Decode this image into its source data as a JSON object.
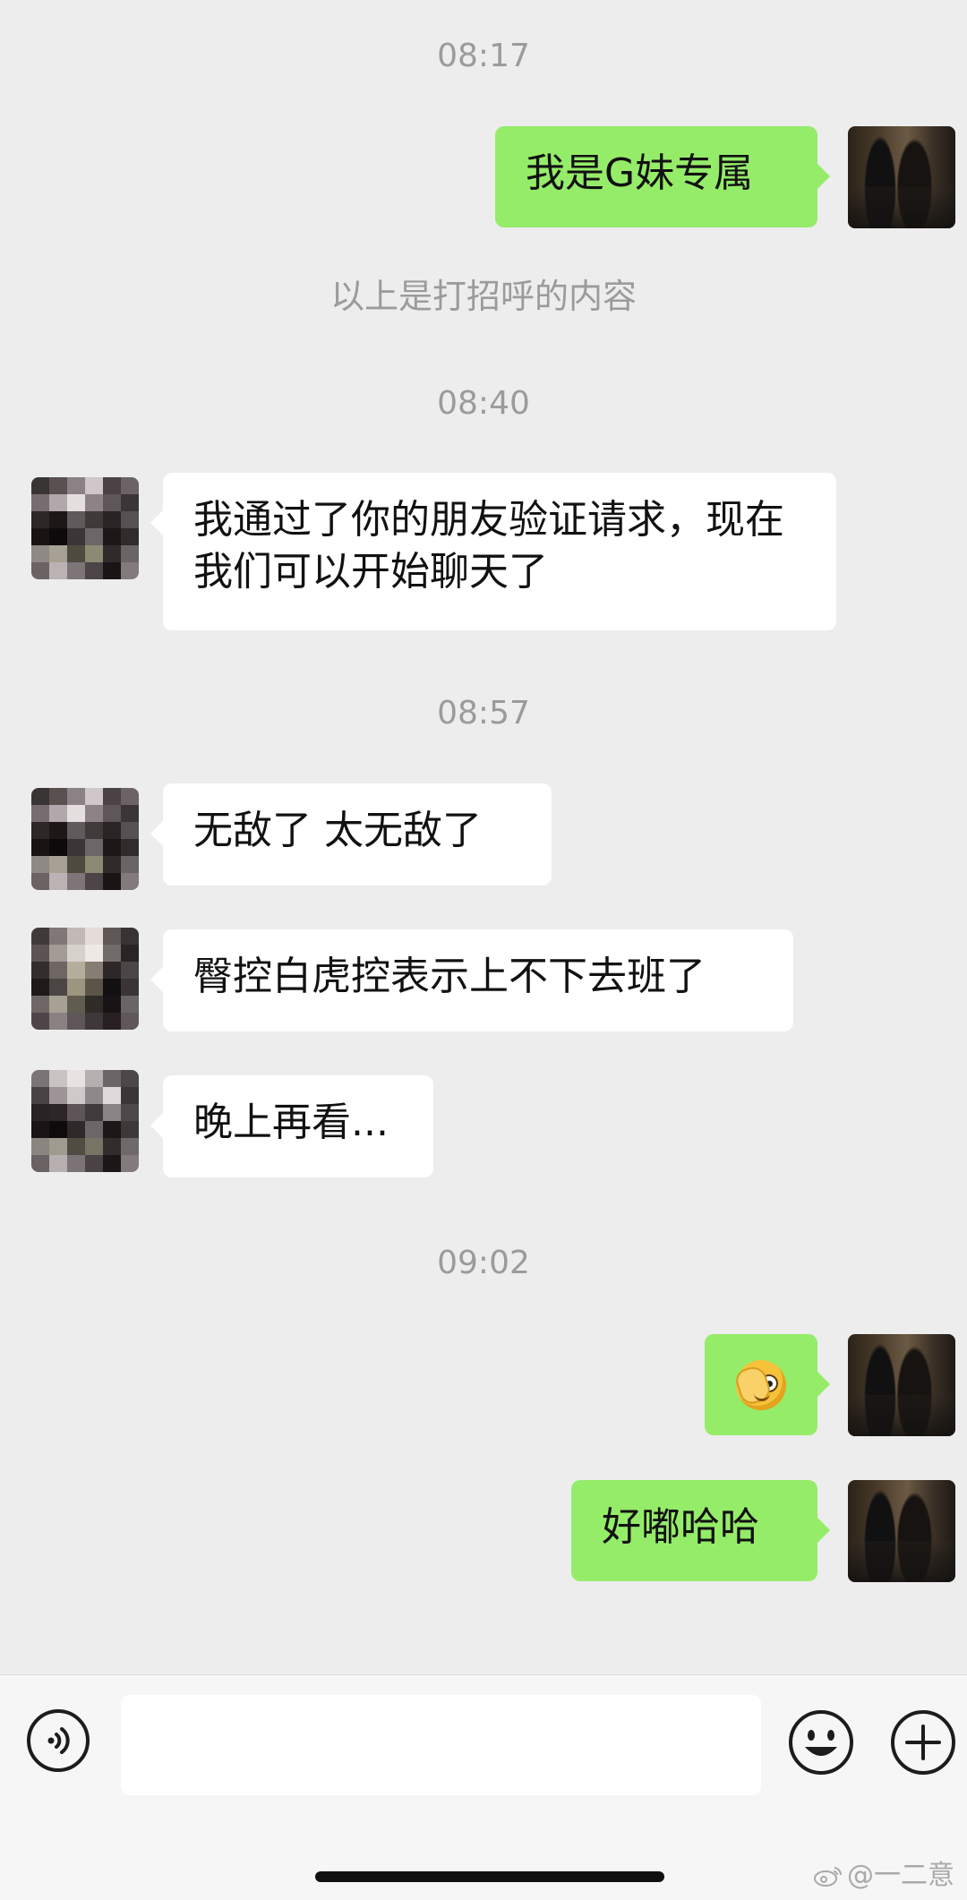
{
  "timestamps": [
    "08:17",
    "08:40",
    "08:57",
    "09:02"
  ],
  "system_note": "以上是打招呼的内容",
  "messages": [
    {
      "side": "me",
      "text": "我是G妹专属"
    },
    {
      "side": "other",
      "text": "我通过了你的朋友验证请求，现在我们可以开始聊天了"
    },
    {
      "side": "other",
      "text": "无敌了 太无敌了"
    },
    {
      "side": "other",
      "text": "臀控白虎控表示上不下去班了"
    },
    {
      "side": "other",
      "text": "晚上再看..."
    },
    {
      "side": "me",
      "type": "emoji",
      "emoji": "face-with-hand-over-eye-emoji"
    },
    {
      "side": "me",
      "text": "好嘟哈哈"
    }
  ],
  "input_bar": {
    "voice_icon": "voice-icon",
    "text_value": "",
    "emoji_icon": "smiley-icon",
    "plus_icon": "plus-icon"
  },
  "watermark": "@一二意",
  "colors": {
    "background": "#ededed",
    "outgoing_bubble": "#95ec69",
    "incoming_bubble": "#ffffff",
    "timestamp_text": "#9b9b9b"
  }
}
